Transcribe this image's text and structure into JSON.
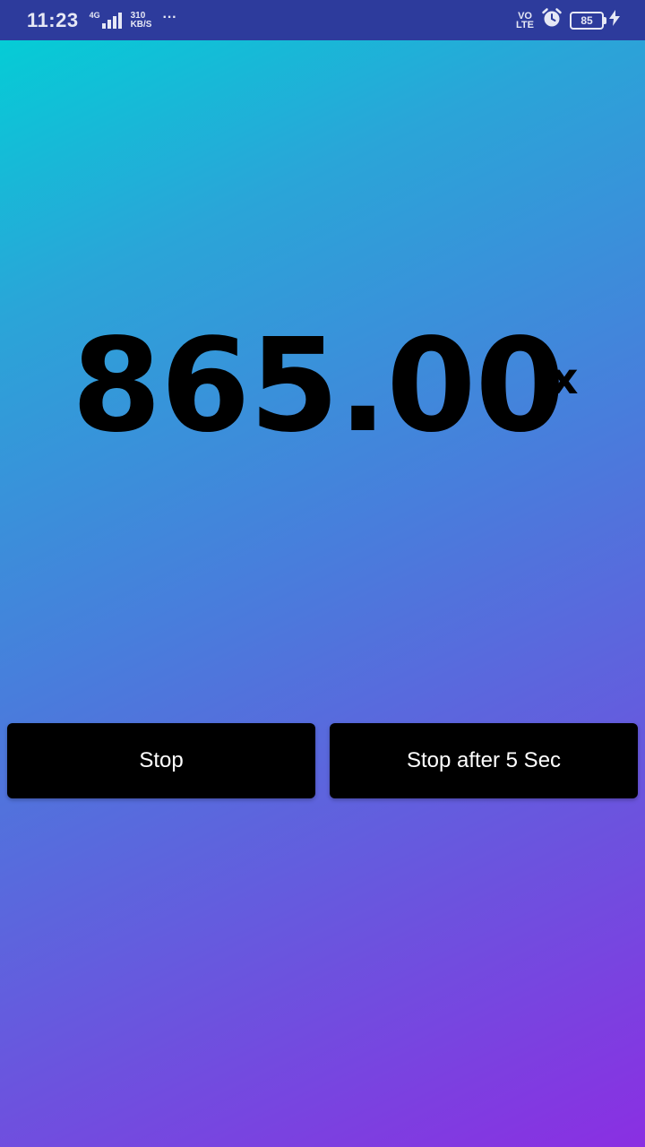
{
  "status_bar": {
    "time": "11:23",
    "network_type": "4G",
    "speed_value": "310",
    "speed_unit": "KB/S",
    "more": "···",
    "volte_top": "VO",
    "volte_bottom": "LTE",
    "battery_level": "85",
    "icons": [
      "signal-icon",
      "alarm-icon",
      "battery-icon",
      "charging-icon"
    ]
  },
  "meter": {
    "value": "865.00",
    "unit": "lx"
  },
  "buttons": {
    "stop_label": "Stop",
    "stop_after_label": "Stop after 5 Sec"
  },
  "colors": {
    "gradient_start": "#00d2d6",
    "gradient_end": "#8a2fe2",
    "status_bar": "#2d3b9c",
    "button": "#000000",
    "button_text": "#ffffff"
  }
}
